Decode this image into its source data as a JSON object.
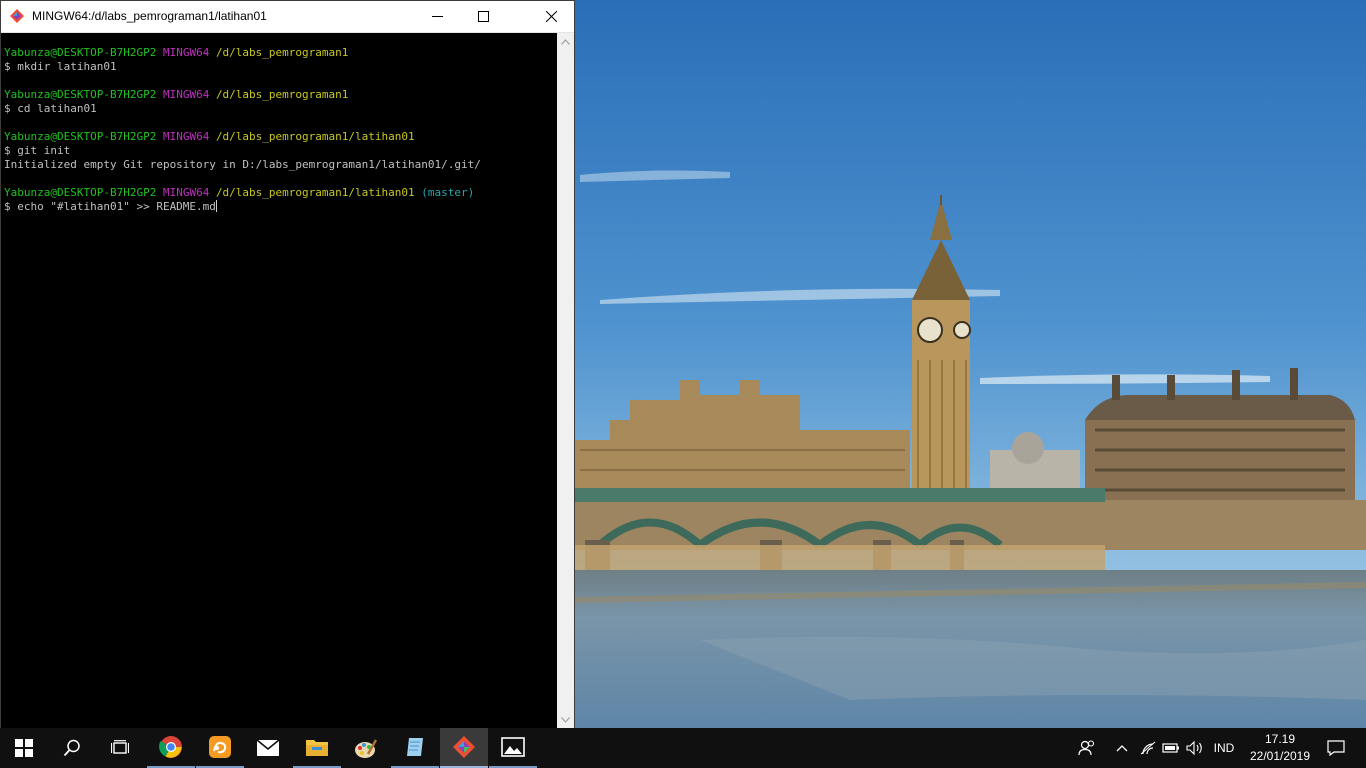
{
  "window": {
    "title": "MINGW64:/d/labs_pemrograman1/latihan01"
  },
  "terminal": {
    "lines": [
      {
        "user": "Yabunza@DESKTOP-B7H2GP2",
        "env": "MINGW64",
        "path": "/d/labs_pemrograman1",
        "branch": ""
      },
      {
        "text": "$ mkdir latihan01"
      },
      {
        "text": ""
      },
      {
        "user": "Yabunza@DESKTOP-B7H2GP2",
        "env": "MINGW64",
        "path": "/d/labs_pemrograman1",
        "branch": ""
      },
      {
        "text": "$ cd latihan01"
      },
      {
        "text": ""
      },
      {
        "user": "Yabunza@DESKTOP-B7H2GP2",
        "env": "MINGW64",
        "path": "/d/labs_pemrograman1/latihan01",
        "branch": ""
      },
      {
        "text": "$ git init"
      },
      {
        "text": "Initialized empty Git repository in D:/labs_pemrograman1/latihan01/.git/"
      },
      {
        "text": ""
      },
      {
        "user": "Yabunza@DESKTOP-B7H2GP2",
        "env": "MINGW64",
        "path": "/d/labs_pemrograman1/latihan01",
        "branch": "(master)"
      },
      {
        "text": "$ echo \"#latihan01\" >> README.md",
        "cursor": true
      }
    ]
  },
  "taskbar": {
    "apps": [
      {
        "icon": "windows-start-icon"
      },
      {
        "icon": "search-icon"
      },
      {
        "icon": "task-view-icon"
      },
      {
        "icon": "chrome-icon"
      },
      {
        "icon": "uc-browser-icon"
      },
      {
        "icon": "mail-icon"
      },
      {
        "icon": "file-explorer-icon"
      },
      {
        "icon": "paint-icon"
      },
      {
        "icon": "notepad-icon"
      },
      {
        "icon": "git-bash-icon"
      },
      {
        "icon": "photos-icon"
      }
    ],
    "tray": {
      "language": "IND",
      "time": "17.19",
      "date": "22/01/2019"
    }
  },
  "colors": {
    "prompt_user": "#1fc21f",
    "prompt_env": "#c030c0",
    "prompt_path": "#c8c820",
    "prompt_branch": "#20a8b0",
    "taskbar_bg": "#101010"
  }
}
